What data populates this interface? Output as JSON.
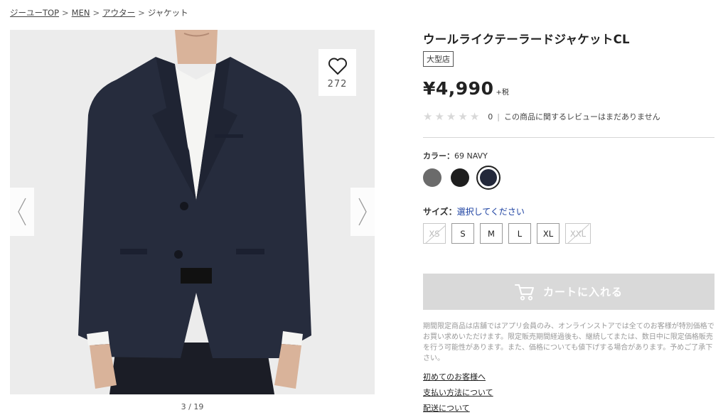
{
  "breadcrumb": {
    "items": [
      "ジーユーTOP",
      "MEN",
      "アウター"
    ],
    "current": "ジャケット",
    "separator": ">"
  },
  "gallery": {
    "favorite_count": "272",
    "pager": "3 / 19"
  },
  "product": {
    "name": "ウールライクテーラードジャケットCL",
    "store_tag": "大型店",
    "price": "¥4,990",
    "tax_note": "+税",
    "review_count": "0",
    "review_separator": "|",
    "review_text": "この商品に関するレビューはまだありません",
    "stars_total": 5,
    "stars_filled": 0
  },
  "color": {
    "label": "カラー：",
    "selected": "69 NAVY",
    "swatches": [
      {
        "name": "gray",
        "hex": "#6b6b6b"
      },
      {
        "name": "black",
        "hex": "#1e1e1e"
      },
      {
        "name": "navy",
        "hex": "#23283a"
      }
    ]
  },
  "size": {
    "label": "サイズ：",
    "prompt": "選択してください",
    "options": [
      {
        "label": "XS",
        "available": false
      },
      {
        "label": "S",
        "available": true
      },
      {
        "label": "M",
        "available": true
      },
      {
        "label": "L",
        "available": true
      },
      {
        "label": "XL",
        "available": true
      },
      {
        "label": "XXL",
        "available": false
      }
    ]
  },
  "cart": {
    "label": "カートに入れる"
  },
  "notice": "期間限定商品は店舗ではアプリ会員のみ、オンラインストアでは全てのお客様が特別価格でお買い求めいただけます。限定販売期間経過後も、継続してまたは、数日中に限定価格販売を行う可能性があります。また、価格についても値下げする場合があります。予めご了承下さい。",
  "links": {
    "first_time": "初めてのお客様へ",
    "payment": "支払い方法について",
    "shipping": "配送について"
  },
  "colors": {
    "accent_blue": "#1a3fa0",
    "cart_disabled": "#d9d9d9"
  }
}
